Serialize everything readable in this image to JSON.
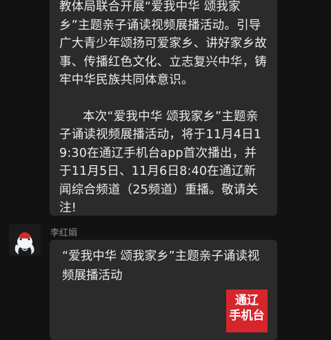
{
  "messages": [
    {
      "paragraphs": [
        "教体局联合开展“爱我中华 颂我家乡”主题亲子诵读视频展播活动。引导广大青少年颂扬可爱家乡、讲好家乡故事、传播红色文化、立志复兴中华，铸牢中华民族共同体意识。",
        "本次“爱我中华 颂我家乡”主题亲子诵读视频展播活动，将于11月4日19:30在通辽手机台app首次播出，并于11月5日、11月6日8:40在通辽新闻综合频道（25频道）重播。敬请关注!"
      ]
    },
    {
      "sender": "李红娟",
      "text": "“爱我中华 颂我家乡”主题亲子诵读视频展播活动",
      "thumbnail": {
        "line1": "通辽",
        "line2": "手机台",
        "color": "#d6262c"
      }
    }
  ],
  "colors": {
    "background": "#121212",
    "bubble": "#2b2b2b",
    "text": "#ececec",
    "sender": "#8d8d8d"
  }
}
